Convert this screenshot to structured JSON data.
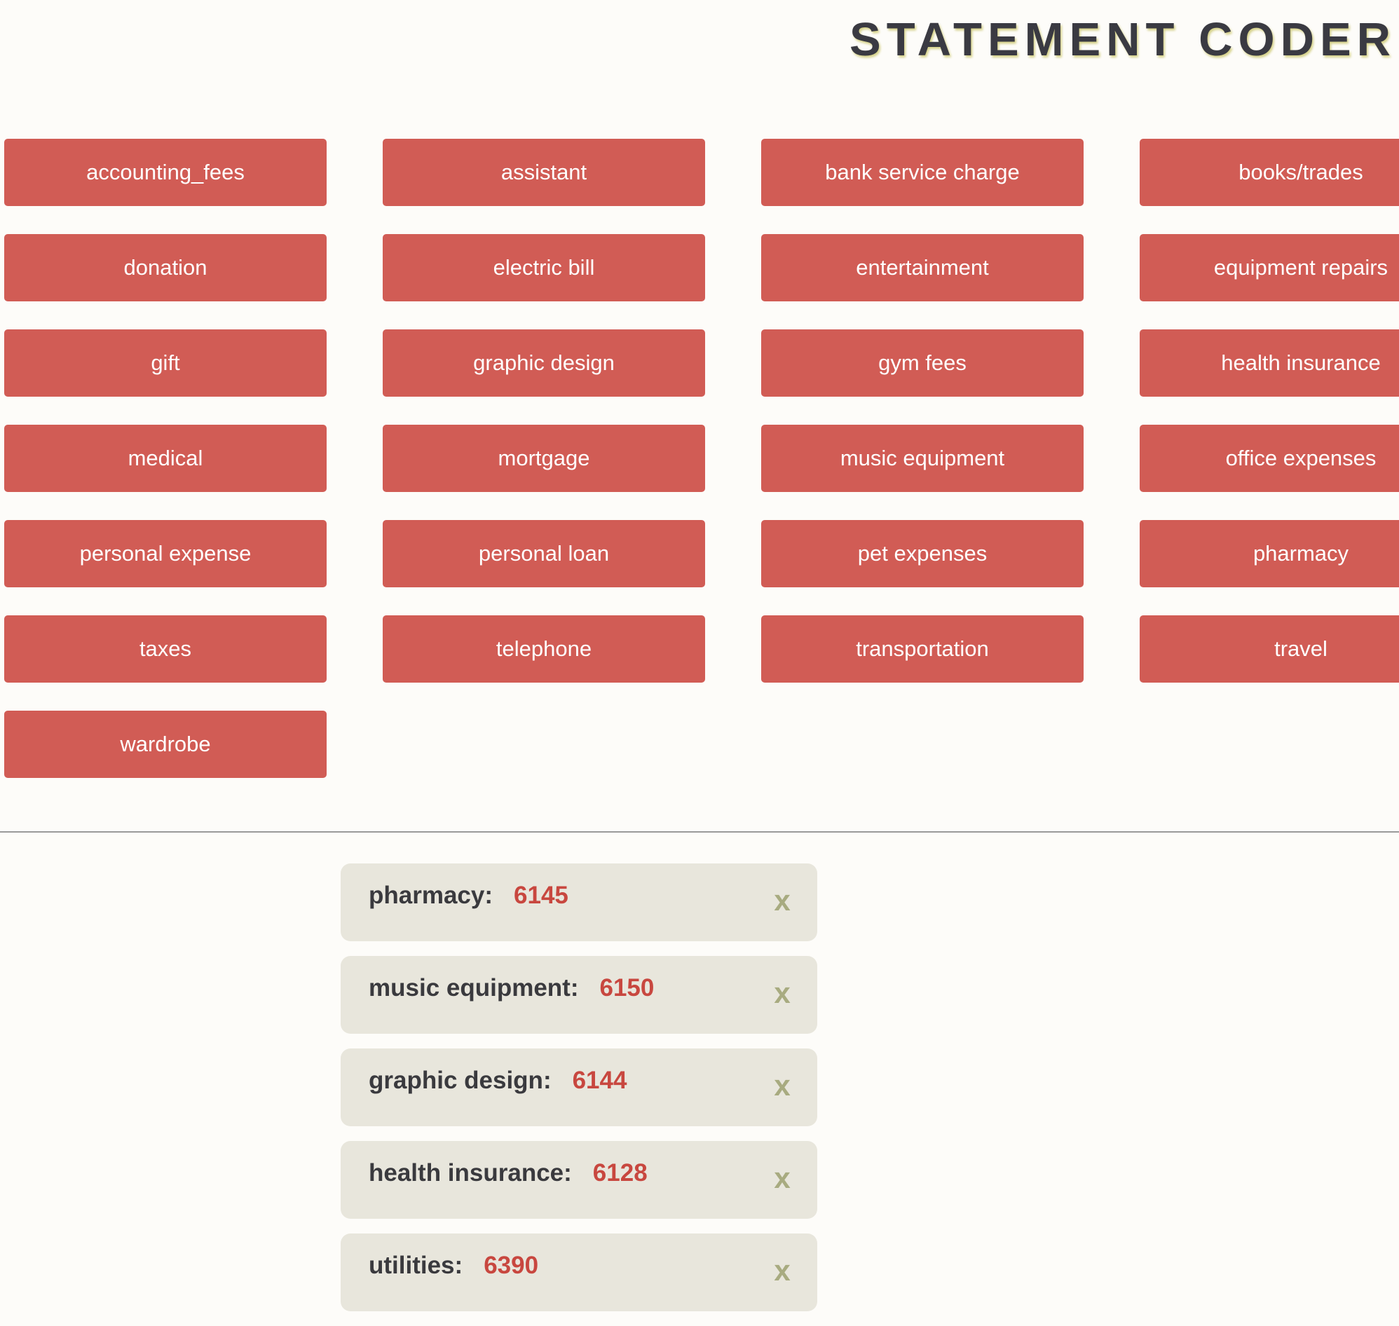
{
  "app": {
    "title": "STATEMENT CODER"
  },
  "categories": [
    "accounting_fees",
    "assistant",
    "bank service charge",
    "books/trades",
    "donation",
    "electric bill",
    "entertainment",
    "equipment repairs",
    "gift",
    "graphic design",
    "gym fees",
    "health insurance",
    "medical",
    "mortgage",
    "music equipment",
    "office expenses",
    "personal expense",
    "personal loan",
    "pet expenses",
    "pharmacy",
    "taxes",
    "telephone",
    "transportation",
    "travel",
    "wardrobe"
  ],
  "coded_items": [
    {
      "name": "pharmacy",
      "code": "6145",
      "remove_label": "x"
    },
    {
      "name": "music equipment",
      "code": "6150",
      "remove_label": "x"
    },
    {
      "name": "graphic design",
      "code": "6144",
      "remove_label": "x"
    },
    {
      "name": "health insurance",
      "code": "6128",
      "remove_label": "x"
    },
    {
      "name": "utilities",
      "code": "6390",
      "remove_label": "x"
    }
  ],
  "colors": {
    "background": "#fdfcf9",
    "category_button": "#d15c55",
    "coded_item_bg": "#e8e6dc",
    "code_text": "#c8473f",
    "remove_x": "#a8ab80",
    "title_text": "#3a3a42"
  }
}
